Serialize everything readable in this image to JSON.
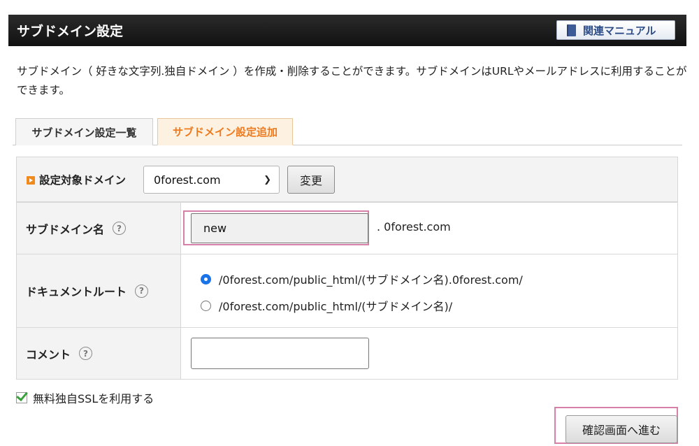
{
  "header": {
    "title": "サブドメイン設定",
    "manual_button": "関連マニュアル",
    "manual_icon": "book-icon"
  },
  "description": "サブドメイン（ 好きな文字列.独自ドメイン ）を作成・削除することができます。サブドメインはURLやメールアドレスに利用することができます。",
  "tabs": [
    {
      "label": "サブドメイン設定一覧",
      "active": false
    },
    {
      "label": "サブドメイン設定追加",
      "active": true
    }
  ],
  "domain_select": {
    "label": "設定対象ドメイン",
    "value": "0forest.com",
    "change_button": "変更"
  },
  "form": {
    "subdomain": {
      "label": "サブドメイン名",
      "value": "new",
      "suffix": ". 0forest.com"
    },
    "docroot": {
      "label": "ドキュメントルート",
      "options": [
        {
          "text": "/0forest.com/public_html/(サブドメイン名).0forest.com/",
          "selected": true
        },
        {
          "text": "/0forest.com/public_html/(サブドメイン名)/",
          "selected": false
        }
      ]
    },
    "comment": {
      "label": "コメント",
      "value": ""
    },
    "help_glyph": "?"
  },
  "ssl_checkbox": {
    "label": "無料独自SSLを利用する",
    "checked": true
  },
  "next_button": "確認画面へ進む",
  "colors": {
    "active_tab": "#ee7a1e",
    "highlight": "#d67fa9",
    "manual_text": "#2e4d87"
  }
}
